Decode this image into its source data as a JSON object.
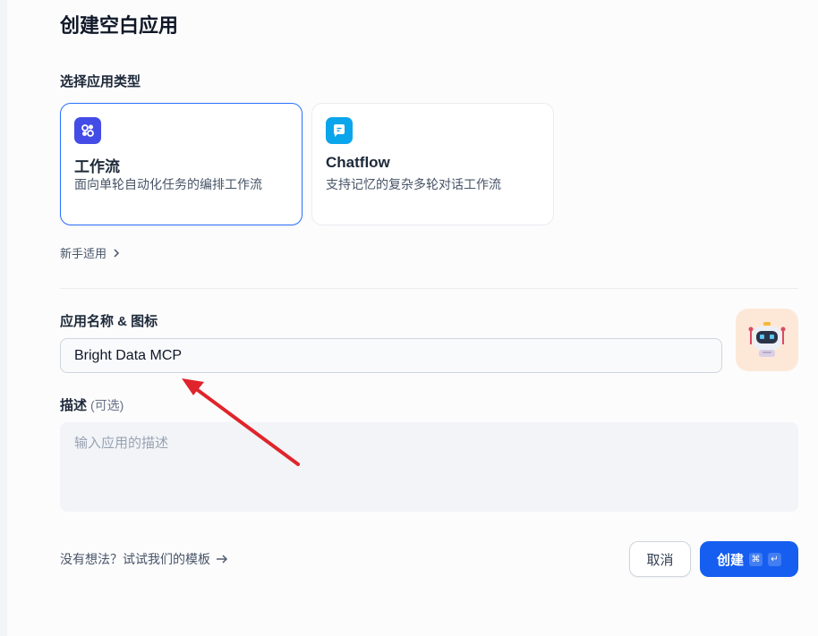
{
  "title": "创建空白应用",
  "app_type": {
    "label": "选择应用类型",
    "cards": [
      {
        "title": "工作流",
        "desc": "面向单轮自动化任务的编排工作流",
        "selected": true
      },
      {
        "title": "Chatflow",
        "desc": "支持记忆的复杂多轮对话工作流",
        "selected": false
      }
    ],
    "beginner_link": "新手适用"
  },
  "name": {
    "label": "应用名称 & 图标",
    "value": "Bright Data MCP"
  },
  "description": {
    "label": "描述",
    "optional": "(可选)",
    "placeholder": "输入应用的描述"
  },
  "footer": {
    "template_link": "没有想法？试试我们的模板",
    "cancel_label": "取消",
    "create_label": "创建",
    "shortcut_cmd": "⌘",
    "shortcut_enter": "↵"
  },
  "colors": {
    "accent": "#155eef",
    "selected_border": "#2970ff",
    "workflow_icon_bg": "#444ce7",
    "chatflow_icon_bg": "#0ba5ec",
    "annotation_arrow": "#e0242b"
  }
}
